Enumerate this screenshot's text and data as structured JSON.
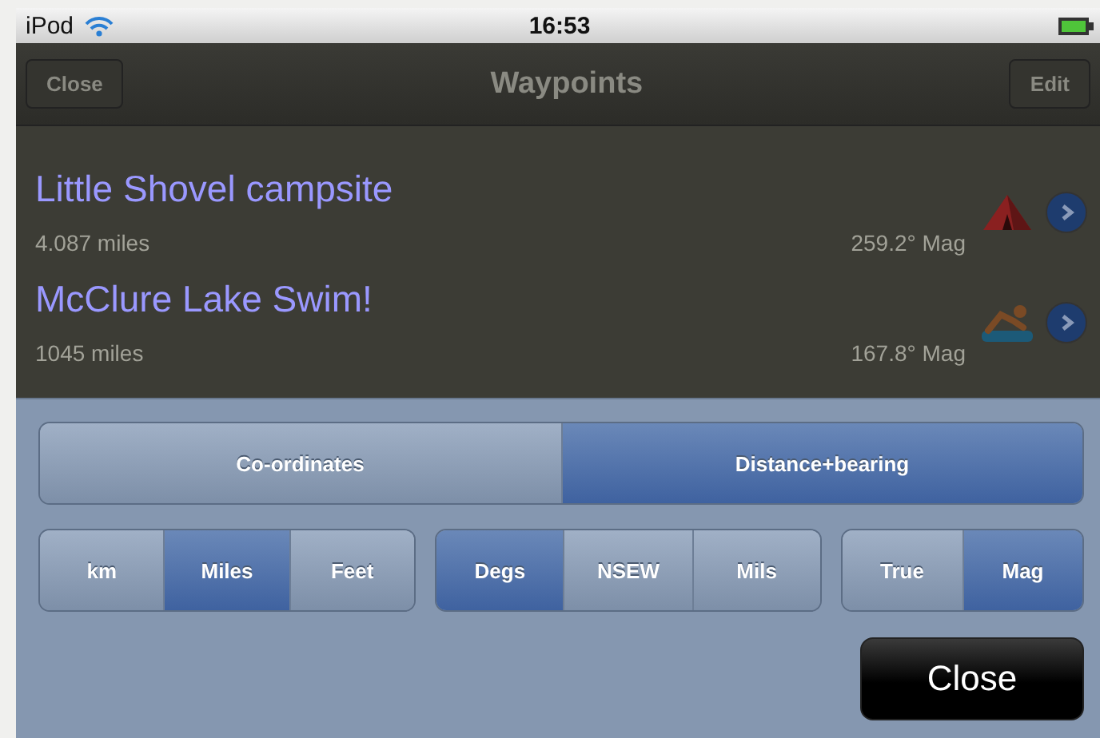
{
  "status_bar": {
    "carrier": "iPod",
    "time": "16:53"
  },
  "nav_bar": {
    "left_button": "Close",
    "title": "Waypoints",
    "right_button": "Edit"
  },
  "waypoints": [
    {
      "name": "Little Shovel campsite",
      "distance": "4.087 miles",
      "bearing": "259.2° Mag",
      "kind": "tent"
    },
    {
      "name": "McClure Lake Swim!",
      "distance": "1045 miles",
      "bearing": "167.8° Mag",
      "kind": "swimmer"
    }
  ],
  "panel": {
    "mode": [
      {
        "label": "Co-ordinates",
        "selected": false
      },
      {
        "label": "Distance+bearing",
        "selected": true
      }
    ],
    "unit_groups": [
      [
        {
          "label": "km",
          "selected": false
        },
        {
          "label": "Miles",
          "selected": true
        },
        {
          "label": "Feet",
          "selected": false
        }
      ],
      [
        {
          "label": "Degs",
          "selected": true
        },
        {
          "label": "NSEW",
          "selected": false
        },
        {
          "label": "Mils",
          "selected": false
        }
      ],
      [
        {
          "label": "True",
          "selected": false
        },
        {
          "label": "Mag",
          "selected": true
        }
      ]
    ],
    "close_button": "Close"
  }
}
